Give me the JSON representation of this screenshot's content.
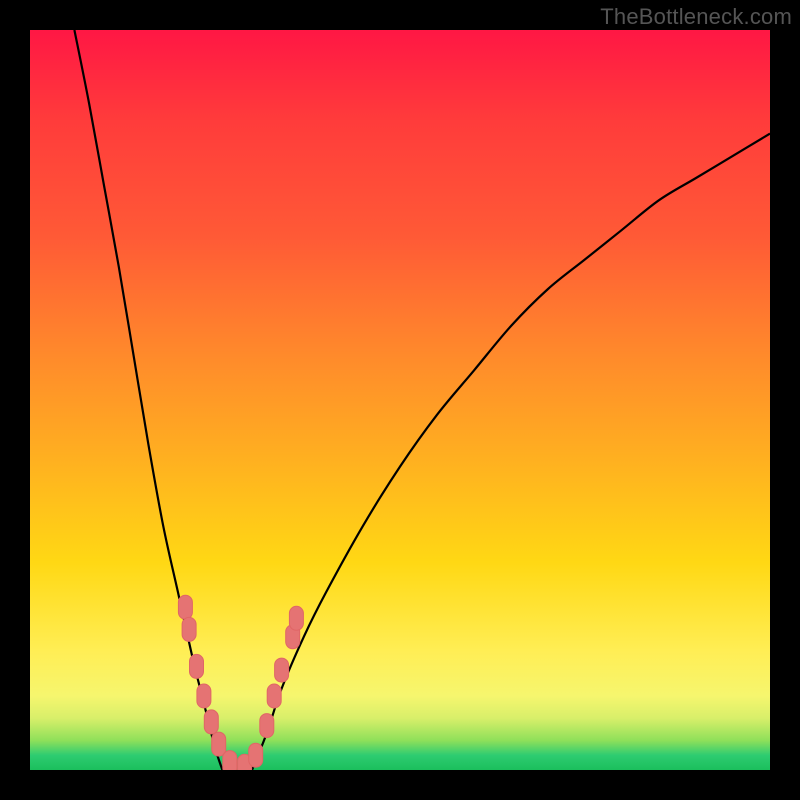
{
  "watermark": "TheBottleneck.com",
  "colors": {
    "page_bg": "#000000",
    "gradient_top": "#ff1744",
    "gradient_mid1": "#ff8a2b",
    "gradient_mid2": "#ffee55",
    "gradient_bottom": "#1bbf5c",
    "curve_stroke": "#000000",
    "marker_fill": "#e57373",
    "marker_stroke": "#e06666"
  },
  "chart_data": {
    "type": "line",
    "title": "",
    "xlabel": "",
    "ylabel": "",
    "xlim": [
      0,
      100
    ],
    "ylim": [
      0,
      100
    ],
    "grid": false,
    "note": "Values are approximate, read visually from the figure. x is horizontal position as % of plot width (left→right), y is vertical position as % of plot height (bottom→top). Trough of the V sits near x≈26–30, y≈0.",
    "series": [
      {
        "name": "left-branch",
        "x": [
          6,
          8,
          10,
          12,
          14,
          16,
          18,
          20,
          22,
          23,
          24,
          25,
          26
        ],
        "y": [
          100,
          90,
          79,
          68,
          56,
          44,
          33,
          24,
          15,
          11,
          7,
          3,
          0
        ]
      },
      {
        "name": "right-branch",
        "x": [
          30,
          32,
          34,
          37,
          40,
          45,
          50,
          55,
          60,
          65,
          70,
          75,
          80,
          85,
          90,
          95,
          100
        ],
        "y": [
          0,
          5,
          11,
          18,
          24,
          33,
          41,
          48,
          54,
          60,
          65,
          69,
          73,
          77,
          80,
          83,
          86
        ]
      }
    ],
    "markers": {
      "name": "highlighted-points",
      "note": "Salmon capsule-shaped markers clustered near bottom of V on both branches.",
      "points": [
        {
          "x": 21.0,
          "y": 22.0
        },
        {
          "x": 21.5,
          "y": 19.0
        },
        {
          "x": 22.5,
          "y": 14.0
        },
        {
          "x": 23.5,
          "y": 10.0
        },
        {
          "x": 24.5,
          "y": 6.5
        },
        {
          "x": 25.5,
          "y": 3.5
        },
        {
          "x": 27.0,
          "y": 1.0
        },
        {
          "x": 29.0,
          "y": 0.5
        },
        {
          "x": 30.5,
          "y": 2.0
        },
        {
          "x": 32.0,
          "y": 6.0
        },
        {
          "x": 33.0,
          "y": 10.0
        },
        {
          "x": 34.0,
          "y": 13.5
        },
        {
          "x": 35.5,
          "y": 18.0
        },
        {
          "x": 36.0,
          "y": 20.5
        }
      ]
    }
  }
}
